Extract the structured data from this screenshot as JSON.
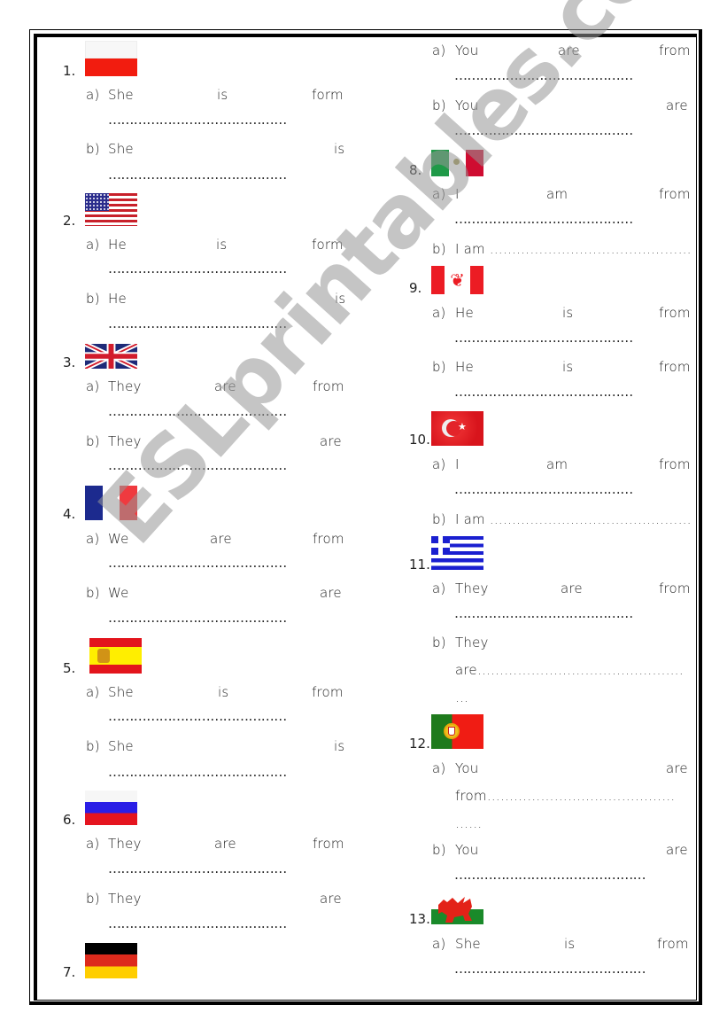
{
  "worksheet": {
    "watermark": "ESLprintables.com",
    "dots_short": "……………………………………",
    "dots_long": "………………………………………",
    "items": [
      {
        "number": "1.",
        "country_flag": "poland-flag-icon",
        "a": {
          "label": "a)",
          "w1": "She",
          "w2": "is",
          "w3": "form"
        },
        "b": {
          "label": "b)",
          "w1": "She",
          "w3": "is"
        }
      },
      {
        "number": "2.",
        "country_flag": "usa-flag-icon",
        "a": {
          "label": "a)",
          "w1": "He",
          "w2": "is",
          "w3": "form"
        },
        "b": {
          "label": "b)",
          "w1": "He",
          "w3": "is"
        }
      },
      {
        "number": "3.",
        "country_flag": "uk-flag-icon",
        "a": {
          "label": "a)",
          "w1": "They",
          "w2": "are",
          "w3": "from"
        },
        "b": {
          "label": "b)",
          "w1": "They",
          "w3": "are"
        }
      },
      {
        "number": "4.",
        "country_flag": "france-flag-icon",
        "a": {
          "label": "a)",
          "w1": "We",
          "w2": "are",
          "w3": "from"
        },
        "b": {
          "label": "b)",
          "w1": "We",
          "w3": "are"
        }
      },
      {
        "number": "5.",
        "country_flag": "spain-flag-icon",
        "a": {
          "label": "a)",
          "w1": "She",
          "w2": "is",
          "w3": "from"
        },
        "b": {
          "label": "b)",
          "w1": "She",
          "w3": "is"
        }
      },
      {
        "number": "6.",
        "country_flag": "russia-flag-icon",
        "a": {
          "label": "a)",
          "w1": "They",
          "w2": "are",
          "w3": "from"
        },
        "b": {
          "label": "b)",
          "w1": "They",
          "w3": "are"
        }
      },
      {
        "number": "7.",
        "country_flag": "germany-flag-icon",
        "a": {
          "label": "a)",
          "w1": "You",
          "w2": "are",
          "w3": "from"
        },
        "b": {
          "label": "b)",
          "w1": "You",
          "w3": "are"
        }
      },
      {
        "number": "8.",
        "country_flag": "mexico-flag-icon",
        "a": {
          "label": "a)",
          "w1": "I",
          "w2": "am",
          "w3": "from"
        },
        "b": {
          "label": "b)",
          "text": "I am ………………………………………."
        }
      },
      {
        "number": "9.",
        "country_flag": "canada-flag-icon",
        "a": {
          "label": "a)",
          "w1": "He",
          "w2": "is",
          "w3": "from"
        },
        "b": {
          "label": "b)",
          "w1": "He",
          "w2": "is",
          "w3": "from"
        }
      },
      {
        "number": "10.",
        "country_flag": "turkey-flag-icon",
        "a": {
          "label": "a)",
          "w1": "I",
          "w2": "am",
          "w3": "from"
        },
        "b": {
          "label": "b)",
          "text": "I am ………………………………………."
        }
      },
      {
        "number": "11.",
        "country_flag": "greece-flag-icon",
        "a": {
          "label": "a)",
          "w1": "They",
          "w2": "are",
          "w3": "from"
        },
        "b": {
          "label": "b)",
          "w1": "They",
          "line2": "are……………………………………….",
          "line3": "…"
        }
      },
      {
        "number": "12.",
        "country_flag": "portugal-flag-icon",
        "a": {
          "label": "a)",
          "w1": "You",
          "w3": "are",
          "line2": "from……………………………………",
          "line3": "……"
        },
        "b": {
          "label": "b)",
          "w1": "You",
          "w3": "are"
        }
      },
      {
        "number": "13.",
        "country_flag": "wales-flag-icon",
        "a": {
          "label": "a)",
          "w1": "She",
          "w2": "is",
          "w3": "from"
        }
      }
    ]
  }
}
